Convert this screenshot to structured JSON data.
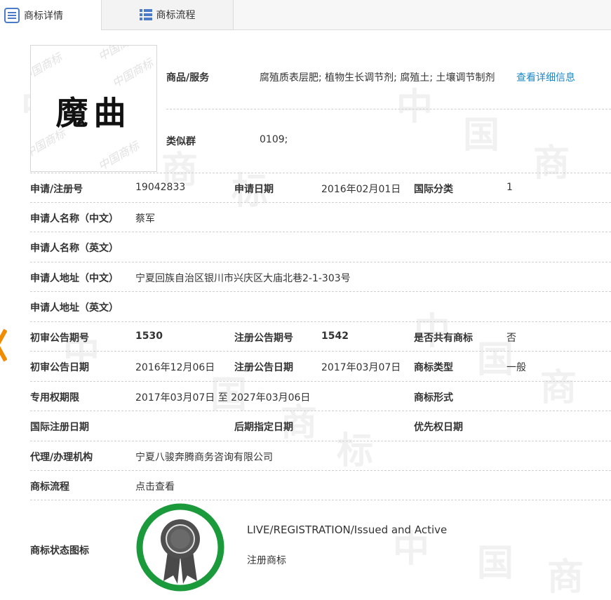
{
  "tabs": [
    {
      "label": "商标详情",
      "icon": "list-detail-icon",
      "active": true
    },
    {
      "label": "商标流程",
      "icon": "grid-flow-icon",
      "active": false
    }
  ],
  "trademark_image": {
    "text": "魔曲",
    "watermark": "中国商标"
  },
  "goods": {
    "label": "商品/服务",
    "value": "腐殖质表层肥; 植物生长调节剂; 腐殖土; 土壤调节制剂",
    "link": "查看详细信息"
  },
  "similar_group": {
    "label": "类似群",
    "value": "0109;"
  },
  "rows": {
    "reg_no": {
      "label": "申请/注册号",
      "value": "19042833"
    },
    "app_date": {
      "label": "申请日期",
      "value": "2016年02月01日"
    },
    "intl_class": {
      "label": "国际分类",
      "value": "1"
    },
    "applicant_cn": {
      "label": "申请人名称（中文）",
      "value": "蔡军"
    },
    "applicant_en": {
      "label": "申请人名称（英文）",
      "value": ""
    },
    "address_cn": {
      "label": "申请人地址（中文）",
      "value": "宁夏回族自治区银川市兴庆区大庙北巷2-1-303号"
    },
    "address_en": {
      "label": "申请人地址（英文）",
      "value": ""
    },
    "prelim_issue": {
      "label": "初审公告期号",
      "value": "1530"
    },
    "reg_issue": {
      "label": "注册公告期号",
      "value": "1542"
    },
    "shared": {
      "label": "是否共有商标",
      "value": "否"
    },
    "prelim_date": {
      "label": "初审公告日期",
      "value": "2016年12月06日"
    },
    "reg_date": {
      "label": "注册公告日期",
      "value": "2017年03月07日"
    },
    "tm_type": {
      "label": "商标类型",
      "value": "一般"
    },
    "term": {
      "label": "专用权期限",
      "value": "2017年03月07日 至 2027年03月06日"
    },
    "tm_form": {
      "label": "商标形式",
      "value": ""
    },
    "intl_reg_date": {
      "label": "国际注册日期",
      "value": ""
    },
    "later_date": {
      "label": "后期指定日期",
      "value": ""
    },
    "priority_date": {
      "label": "优先权日期",
      "value": ""
    },
    "agent": {
      "label": "代理/办理机构",
      "value": "宁夏八骏奔腾商务咨询有限公司"
    },
    "flow": {
      "label": "商标流程",
      "link": "点击查看"
    },
    "status_icon": {
      "label": "商标状态图标"
    }
  },
  "status": {
    "en": "LIVE/REGISTRATION/Issued and Active",
    "cn": "注册商标",
    "icon": "registered-medal-icon",
    "ring_color": "#1a9a3a"
  },
  "colors": {
    "link": "#1b88c7",
    "accent_arrow": "#f08c00",
    "tab_icon": "#4a7bc8"
  }
}
